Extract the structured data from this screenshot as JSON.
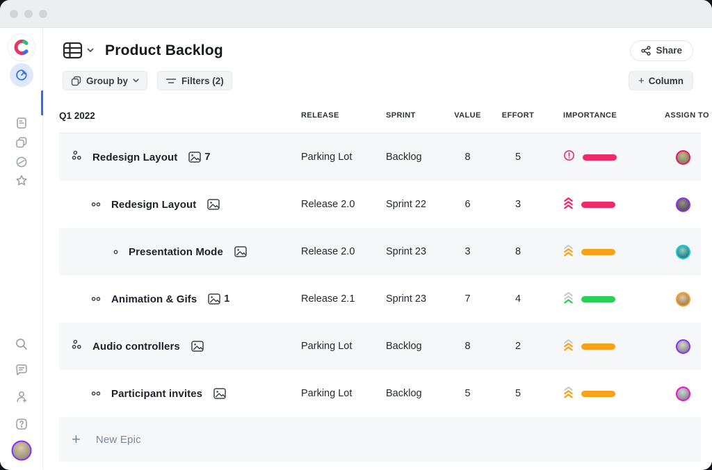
{
  "colors": {
    "accent_blue": "#2e6bf0",
    "pink": "#ee2b68",
    "orange": "#f7a219",
    "green": "#27d157",
    "chevron_grey": "#c9ccd1"
  },
  "sidebar": {
    "logo": "craft-logo",
    "nav_icons": [
      "dashboard-icon",
      "notes-icon",
      "boards-icon",
      "blocked-icon",
      "star-icon"
    ],
    "bottom_icons": [
      "search-icon",
      "comments-icon",
      "invite-user-icon",
      "help-icon"
    ],
    "user_avatar_ring": "#8b2ff5"
  },
  "header": {
    "title": "Product Backlog",
    "share_label": "Share"
  },
  "toolbar": {
    "group_by_label": "Group by",
    "filters_label": "Filters (2)",
    "add_column_label": "Column",
    "add_column_plus": "+"
  },
  "table": {
    "group_label": "Q1 2022",
    "columns": [
      "RELEASE",
      "SPRINT",
      "VALUE",
      "EFFORT",
      "IMPORTANCE",
      "ASSIGN TO"
    ],
    "rows": [
      {
        "type": "epic",
        "name": "Redesign Layout",
        "attachment_count": "7",
        "release": "Parking Lot",
        "sprint": "Backlog",
        "value": "8",
        "effort": "5",
        "importance": {
          "icon": "alert",
          "bar": "#ee2b68",
          "chevrons": null
        },
        "avatar_ring": "#e8175d",
        "shade": true
      },
      {
        "type": "story",
        "name": "Redesign Layout",
        "attachment_count": null,
        "release": "Release 2.0",
        "sprint": "Sprint 22",
        "value": "6",
        "effort": "3",
        "importance": {
          "icon": "chevrons",
          "bar": "#ee2b68",
          "chevrons": [
            "#ee2b68",
            "#ee2b68",
            "#ee2b68"
          ]
        },
        "avatar_ring": "#8b2ff5",
        "shade": false
      },
      {
        "type": "substory",
        "name": "Presentation Mode",
        "attachment_count": null,
        "release": "Release 2.0",
        "sprint": "Sprint 23",
        "value": "3",
        "effort": "8",
        "importance": {
          "icon": "chevrons",
          "bar": "#f7a219",
          "chevrons": [
            "#c9ccd1",
            "#f7a219",
            "#f7a219"
          ]
        },
        "avatar_ring": "#19c8d2",
        "shade": true
      },
      {
        "type": "story",
        "name": "Animation & Gifs",
        "attachment_count": "1",
        "release": "Release 2.1",
        "sprint": "Sprint 23",
        "value": "7",
        "effort": "4",
        "importance": {
          "icon": "chevrons",
          "bar": "#27d157",
          "chevrons": [
            "#c9ccd1",
            "#c9ccd1",
            "#27d157"
          ]
        },
        "avatar_ring": "#f5a01d",
        "shade": false
      },
      {
        "type": "epic",
        "name": "Audio controllers",
        "attachment_count": null,
        "release": "Parking Lot",
        "sprint": "Backlog",
        "value": "8",
        "effort": "2",
        "importance": {
          "icon": "chevrons",
          "bar": "#f7a219",
          "chevrons": [
            "#c9ccd1",
            "#f7a219",
            "#f7a219"
          ]
        },
        "avatar_ring": "#8b2ff5",
        "shade": true
      },
      {
        "type": "story",
        "name": "Participant invites",
        "attachment_count": null,
        "release": "Parking Lot",
        "sprint": "Backlog",
        "value": "5",
        "effort": "5",
        "importance": {
          "icon": "chevrons",
          "bar": "#f7a219",
          "chevrons": [
            "#c9ccd1",
            "#f7a219",
            "#f7a219"
          ]
        },
        "avatar_ring": "#ef13c4",
        "shade": false
      }
    ],
    "new_epic_label": "New Epic",
    "new_epic_plus": "+"
  }
}
